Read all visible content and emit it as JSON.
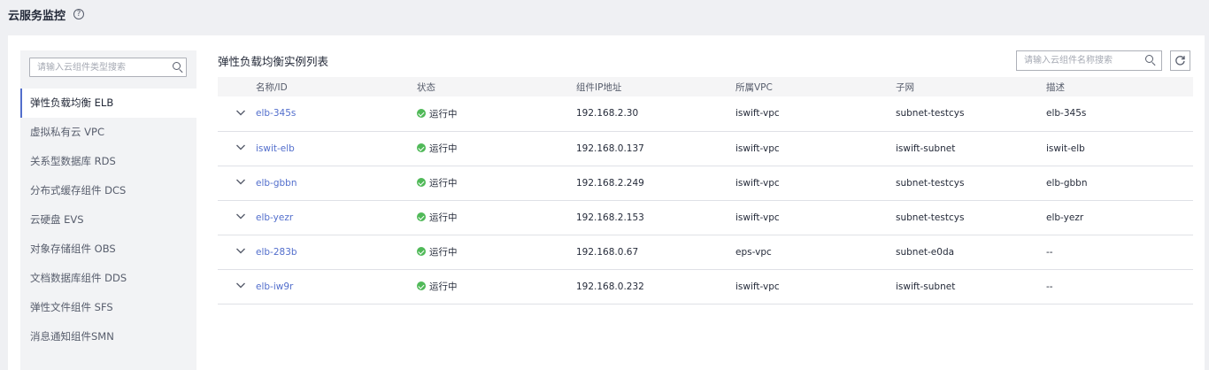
{
  "header": {
    "title": "云服务监控",
    "help_icon": "?"
  },
  "sidebar": {
    "search_placeholder": "请输入云组件类型搜索",
    "items": [
      {
        "label": "弹性负载均衡 ELB",
        "active": true
      },
      {
        "label": "虚拟私有云 VPC"
      },
      {
        "label": "关系型数据库 RDS"
      },
      {
        "label": "分布式缓存组件 DCS"
      },
      {
        "label": "云硬盘 EVS"
      },
      {
        "label": "对象存储组件 OBS"
      },
      {
        "label": "文档数据库组件 DDS"
      },
      {
        "label": "弹性文件组件 SFS"
      },
      {
        "label": "消息通知组件SMN"
      }
    ]
  },
  "main": {
    "title": "弹性负载均衡实例列表",
    "search_placeholder": "请输入云组件名称搜索",
    "columns": [
      "名称/ID",
      "状态",
      "组件IP地址",
      "所属VPC",
      "子网",
      "描述"
    ],
    "rows": [
      {
        "name": "elb-345s",
        "status": "运行中",
        "ip": "192.168.2.30",
        "vpc": "iswift-vpc",
        "subnet": "subnet-testcys",
        "desc": "elb-345s"
      },
      {
        "name": "iswit-elb",
        "status": "运行中",
        "ip": "192.168.0.137",
        "vpc": "iswift-vpc",
        "subnet": "iswift-subnet",
        "desc": "iswit-elb"
      },
      {
        "name": "elb-gbbn",
        "status": "运行中",
        "ip": "192.168.2.249",
        "vpc": "iswift-vpc",
        "subnet": "subnet-testcys",
        "desc": "elb-gbbn"
      },
      {
        "name": "elb-yezr",
        "status": "运行中",
        "ip": "192.168.2.153",
        "vpc": "iswift-vpc",
        "subnet": "subnet-testcys",
        "desc": "elb-yezr"
      },
      {
        "name": "elb-283b",
        "status": "运行中",
        "ip": "192.168.0.67",
        "vpc": "eps-vpc",
        "subnet": "subnet-e0da",
        "desc": "--"
      },
      {
        "name": "elb-iw9r",
        "status": "运行中",
        "ip": "192.168.0.232",
        "vpc": "iswift-vpc",
        "subnet": "iswift-subnet",
        "desc": "--"
      }
    ]
  },
  "colors": {
    "accent": "#526ecc",
    "status_running": "#50b958",
    "page_bg": "#eff0f3"
  }
}
